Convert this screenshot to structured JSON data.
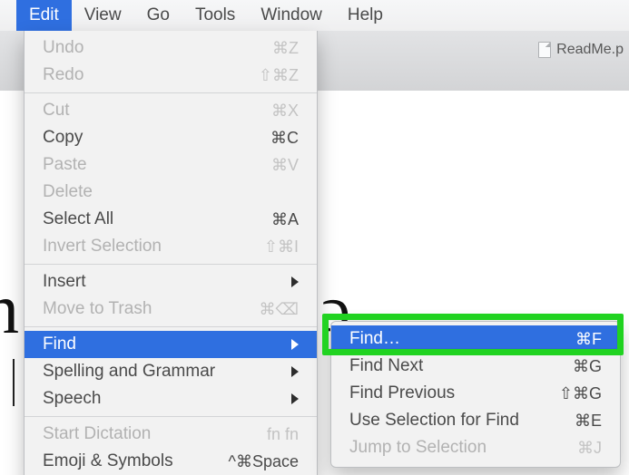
{
  "menubar": {
    "items": [
      {
        "label": "Edit",
        "active": true
      },
      {
        "label": "View"
      },
      {
        "label": "Go"
      },
      {
        "label": "Tools"
      },
      {
        "label": "Window"
      },
      {
        "label": "Help"
      }
    ]
  },
  "toolbar": {
    "readme_label": "ReadMe.p"
  },
  "background": {
    "left_glyph": "n",
    "right_glyph": "ɔ"
  },
  "edit_menu": {
    "undo": {
      "label": "Undo",
      "shortcut": "⌘Z"
    },
    "redo": {
      "label": "Redo",
      "shortcut": "⇧⌘Z"
    },
    "cut": {
      "label": "Cut",
      "shortcut": "⌘X"
    },
    "copy": {
      "label": "Copy",
      "shortcut": "⌘C"
    },
    "paste": {
      "label": "Paste",
      "shortcut": "⌘V"
    },
    "delete": {
      "label": "Delete",
      "shortcut": ""
    },
    "select_all": {
      "label": "Select All",
      "shortcut": "⌘A"
    },
    "invert_selection": {
      "label": "Invert Selection",
      "shortcut": "⇧⌘I"
    },
    "insert": {
      "label": "Insert",
      "shortcut": ""
    },
    "move_to_trash": {
      "label": "Move to Trash",
      "shortcut": "⌘⌫"
    },
    "find": {
      "label": "Find",
      "shortcut": ""
    },
    "spelling": {
      "label": "Spelling and Grammar",
      "shortcut": ""
    },
    "speech": {
      "label": "Speech",
      "shortcut": ""
    },
    "start_dictation": {
      "label": "Start Dictation",
      "shortcut": "fn fn"
    },
    "emoji": {
      "label": "Emoji & Symbols",
      "shortcut": "^⌘Space"
    }
  },
  "find_submenu": {
    "find": {
      "label": "Find…",
      "shortcut": "⌘F"
    },
    "find_next": {
      "label": "Find Next",
      "shortcut": "⌘G"
    },
    "find_previous": {
      "label": "Find Previous",
      "shortcut": "⇧⌘G"
    },
    "use_selection": {
      "label": "Use Selection for Find",
      "shortcut": "⌘E"
    },
    "jump": {
      "label": "Jump to Selection",
      "shortcut": "⌘J"
    }
  }
}
